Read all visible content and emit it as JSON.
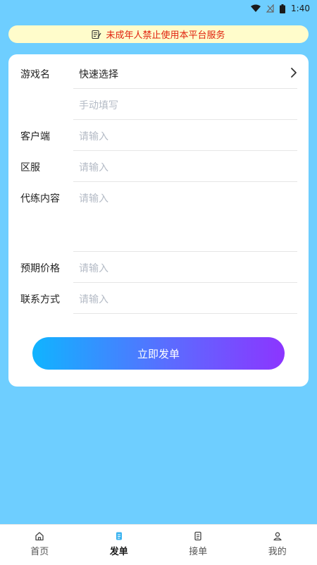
{
  "status_bar": {
    "time": "1:40"
  },
  "notice": {
    "text": "未成年人禁止使用本平台服务"
  },
  "form": {
    "game": {
      "label": "游戏名",
      "quick_select": "快速选择",
      "manual_placeholder": "手动填写"
    },
    "client": {
      "label": "客户端",
      "placeholder": "请输入"
    },
    "server": {
      "label": "区服",
      "placeholder": "请输入"
    },
    "content": {
      "label": "代练内容",
      "placeholder": "请输入"
    },
    "price": {
      "label": "预期价格",
      "placeholder": "请输入"
    },
    "contact": {
      "label": "联系方式",
      "placeholder": "请输入"
    },
    "submit_label": "立即发单"
  },
  "tabs": [
    {
      "label": "首页",
      "icon": "home-icon"
    },
    {
      "label": "发单",
      "icon": "post-order-icon",
      "active": true
    },
    {
      "label": "接单",
      "icon": "accept-order-icon"
    },
    {
      "label": "我的",
      "icon": "profile-icon"
    }
  ],
  "colors": {
    "background": "#6ECEFF",
    "notice_bg": "#FFFCCB",
    "notice_text": "#E0220E",
    "active_tab_icon": "#3CB4F0",
    "button_gradient_start": "#10B4FF",
    "button_gradient_end": "#8C35FF"
  }
}
